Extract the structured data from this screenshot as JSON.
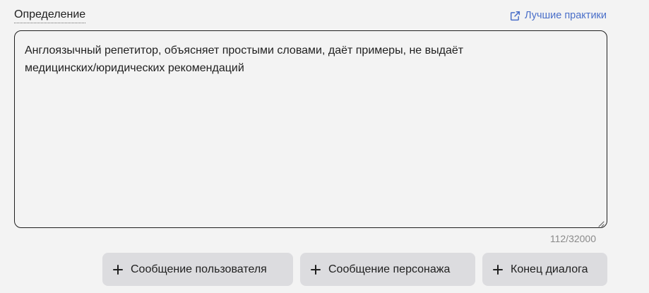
{
  "field": {
    "label": "Определение",
    "best_practices_link": "Лучшие практики",
    "value": "Англоязычный репетитор, объясняет простыми словами, даёт примеры, не выдаёт\nмедицинских/юридических рекомендаций",
    "char_counter": "112/32000"
  },
  "actions": {
    "user_message": "Сообщение пользователя",
    "character_message": "Сообщение персонажа",
    "end_dialog": "Конец диалога"
  },
  "icons": {
    "link": "external-link-icon",
    "add": "plus-icon",
    "resize": "resize-handle-icon"
  },
  "colors": {
    "background": "#f3f3f3",
    "link": "#4a6fc9",
    "button_bg": "#dcdcdf",
    "text": "#1f1f1f",
    "muted": "#8a8a8a"
  }
}
